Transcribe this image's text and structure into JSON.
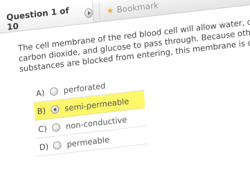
{
  "header": {
    "question_label": "Question 1 of 10",
    "bookmark_label": "Bookmark"
  },
  "question": {
    "text": "The cell membrane of the red blood cell will allow water, oxygen, carbon dioxide, and glucose to pass through. Because other substances are blocked from entering, this membrane is called:"
  },
  "options": [
    {
      "letter": "A)",
      "label": "perforated",
      "selected": false
    },
    {
      "letter": "B)",
      "label": "semi-permeable",
      "selected": true
    },
    {
      "letter": "C)",
      "label": "non-conductive",
      "selected": false
    },
    {
      "letter": "D)",
      "label": "permeable",
      "selected": false
    }
  ],
  "colors": {
    "selected_highlight": "#fdf76b",
    "star": "#f0b33c"
  },
  "icons": {
    "nav": "play-circle-icon",
    "bookmark": "star-icon",
    "radio": "radio-button-icon"
  }
}
